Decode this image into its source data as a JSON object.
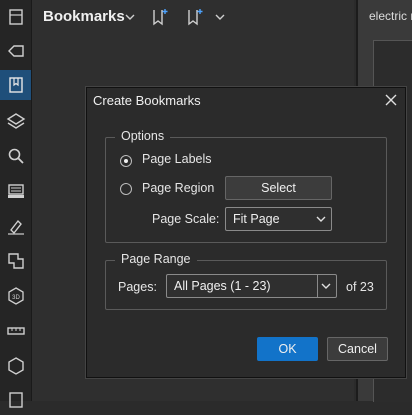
{
  "panel": {
    "title": "Bookmarks"
  },
  "document": {
    "visible_text": "electric r"
  },
  "rail": {
    "tools": [
      {
        "icon": "file-icon",
        "active": false
      },
      {
        "icon": "tag-icon",
        "active": false
      },
      {
        "icon": "bookmarks-icon",
        "active": true
      },
      {
        "icon": "layers-icon",
        "active": false
      },
      {
        "icon": "search-icon",
        "active": false
      },
      {
        "icon": "stamp-icon",
        "active": false
      },
      {
        "icon": "signature-icon",
        "active": false
      },
      {
        "icon": "spaces-icon",
        "active": false
      },
      {
        "icon": "3d-icon",
        "active": false
      },
      {
        "icon": "measure-icon",
        "active": false
      },
      {
        "icon": "shape-icon",
        "active": false
      },
      {
        "icon": "document-icon",
        "active": false
      }
    ]
  },
  "dialog": {
    "title": "Create Bookmarks",
    "options": {
      "legend": "Options",
      "page_labels": "Page Labels",
      "page_region": "Page Region",
      "select_button": "Select",
      "page_scale_label": "Page Scale:",
      "page_scale_value": "Fit Page",
      "selected_option": "Page Labels"
    },
    "page_range": {
      "legend": "Page Range",
      "pages_label": "Pages:",
      "pages_value": "All Pages (1 - 23)",
      "of_text": "of 23"
    },
    "ok_button": "OK",
    "cancel_button": "Cancel"
  },
  "colors": {
    "accent": "#1273c9",
    "active_tool": "#1f4f7a",
    "background": "#2b2b2b"
  }
}
